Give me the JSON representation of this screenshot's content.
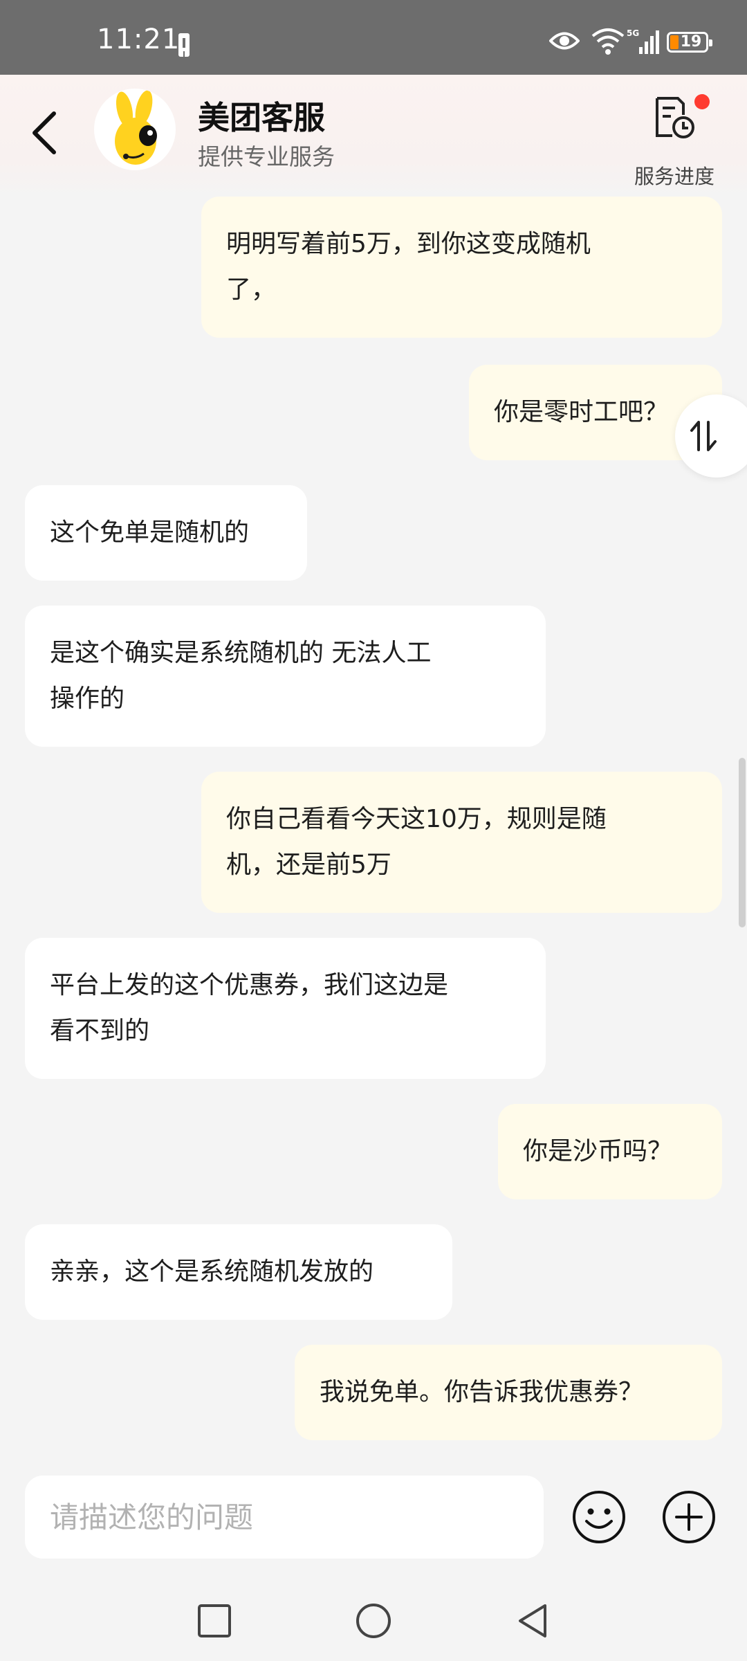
{
  "status_bar": {
    "time": "11:21",
    "battery": "19",
    "network": "5G"
  },
  "header": {
    "title": "美团客服",
    "subtitle": "提供专业服务",
    "progress_label": "服务进度"
  },
  "messages": [
    {
      "role": "user",
      "lines": [
        "明明写着前5万，到你这变成随机",
        "了，"
      ]
    },
    {
      "role": "user",
      "lines": [
        "你是零时工吧？"
      ]
    },
    {
      "role": "agent",
      "lines": [
        "这个免单是随机的"
      ]
    },
    {
      "role": "agent",
      "lines": [
        "是这个确实是系统随机的 无法人工",
        "操作的"
      ]
    },
    {
      "role": "user",
      "lines": [
        "你自己看看今天这10万，规则是随",
        "机，还是前5万"
      ]
    },
    {
      "role": "agent",
      "lines": [
        "平台上发的这个优惠券，我们这边是",
        "看不到的"
      ]
    },
    {
      "role": "user",
      "lines": [
        "你是沙币吗？"
      ]
    },
    {
      "role": "agent",
      "lines": [
        "亲亲，这个是系统随机发放的"
      ]
    },
    {
      "role": "user",
      "lines": [
        "我说免单。你告诉我优惠券？"
      ]
    }
  ],
  "input": {
    "placeholder": "请描述您的问题",
    "value": ""
  },
  "colors": {
    "user_bubble": "#fffbea",
    "agent_bubble": "#ffffff",
    "badge": "#ff3b30",
    "mascot_yellow": "#ffd21f"
  },
  "icons": [
    "back-icon",
    "mascot-avatar",
    "service-progress-icon",
    "scroll-toggle-icon",
    "emoji-icon",
    "plus-icon",
    "recents-icon",
    "home-icon",
    "back-nav-icon"
  ]
}
